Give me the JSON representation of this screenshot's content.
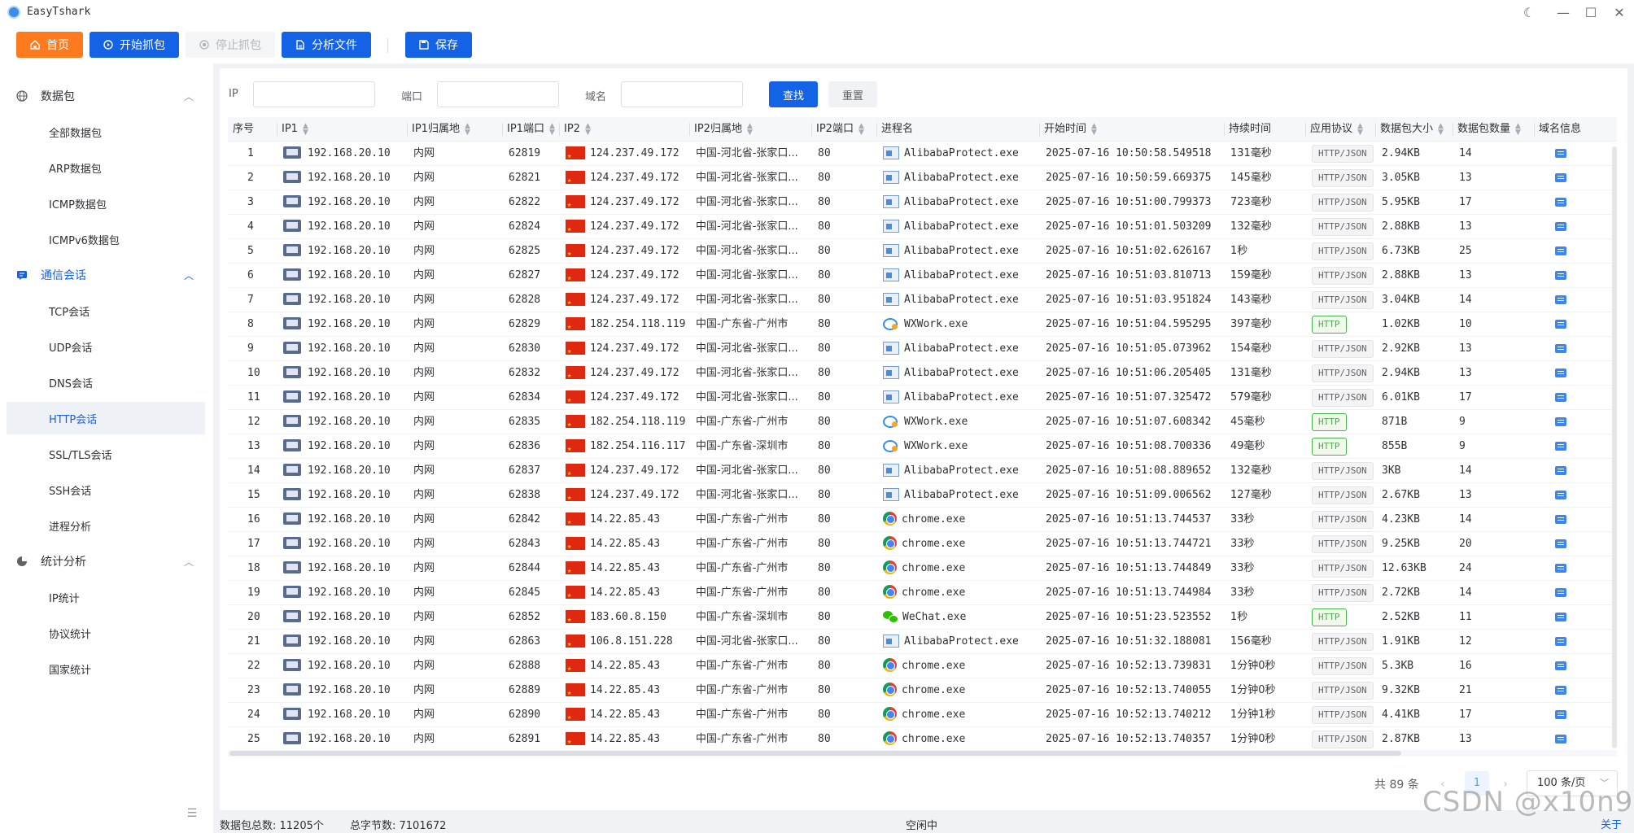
{
  "app": {
    "title": "EasyTshark"
  },
  "toolbar": {
    "home_label": "首页",
    "start_label": "开始抓包",
    "stop_label": "停止抓包",
    "analyze_label": "分析文件",
    "save_label": "保存"
  },
  "sidebar": {
    "groups": [
      {
        "label": "数据包",
        "icon": "globe-icon",
        "items": [
          "全部数据包",
          "ARP数据包",
          "ICMP数据包",
          "ICMPv6数据包"
        ]
      },
      {
        "label": "通信会话",
        "icon": "chat-icon",
        "items": [
          "TCP会话",
          "UDP会话",
          "DNS会话",
          "HTTP会话",
          "SSL/TLS会话",
          "SSH会话",
          "进程分析"
        ]
      },
      {
        "label": "统计分析",
        "icon": "pie-chart-icon",
        "items": [
          "IP统计",
          "协议统计",
          "国家统计"
        ]
      }
    ],
    "active_item": "HTTP会话"
  },
  "filters": {
    "ip_label": "IP",
    "port_label": "端口",
    "domain_label": "域名",
    "ip_value": "",
    "port_value": "",
    "domain_value": "",
    "search_label": "查找",
    "reset_label": "重置"
  },
  "table": {
    "headers": [
      "序号",
      "IP1",
      "IP1归属地",
      "IP1端口",
      "IP2",
      "IP2归属地",
      "IP2端口",
      "进程名",
      "开始时间",
      "持续时间",
      "应用协议",
      "数据包大小",
      "数据包数量",
      "域名信息"
    ],
    "rows": [
      [
        "1",
        "192.168.20.10",
        "内网",
        "62819",
        "124.237.49.172",
        "中国-河北省-张家口...",
        "80",
        "AlibabaProtect.exe",
        "2025-07-16 10:50:58.549518",
        "131毫秒",
        "HTTP/JSON",
        "2.94KB",
        "14"
      ],
      [
        "2",
        "192.168.20.10",
        "内网",
        "62821",
        "124.237.49.172",
        "中国-河北省-张家口...",
        "80",
        "AlibabaProtect.exe",
        "2025-07-16 10:50:59.669375",
        "145毫秒",
        "HTTP/JSON",
        "3.05KB",
        "13"
      ],
      [
        "3",
        "192.168.20.10",
        "内网",
        "62822",
        "124.237.49.172",
        "中国-河北省-张家口...",
        "80",
        "AlibabaProtect.exe",
        "2025-07-16 10:51:00.799373",
        "723毫秒",
        "HTTP/JSON",
        "5.95KB",
        "17"
      ],
      [
        "4",
        "192.168.20.10",
        "内网",
        "62824",
        "124.237.49.172",
        "中国-河北省-张家口...",
        "80",
        "AlibabaProtect.exe",
        "2025-07-16 10:51:01.503209",
        "132毫秒",
        "HTTP/JSON",
        "2.88KB",
        "13"
      ],
      [
        "5",
        "192.168.20.10",
        "内网",
        "62825",
        "124.237.49.172",
        "中国-河北省-张家口...",
        "80",
        "AlibabaProtect.exe",
        "2025-07-16 10:51:02.626167",
        "1秒",
        "HTTP/JSON",
        "6.73KB",
        "25"
      ],
      [
        "6",
        "192.168.20.10",
        "内网",
        "62827",
        "124.237.49.172",
        "中国-河北省-张家口...",
        "80",
        "AlibabaProtect.exe",
        "2025-07-16 10:51:03.810713",
        "159毫秒",
        "HTTP/JSON",
        "2.88KB",
        "13"
      ],
      [
        "7",
        "192.168.20.10",
        "内网",
        "62828",
        "124.237.49.172",
        "中国-河北省-张家口...",
        "80",
        "AlibabaProtect.exe",
        "2025-07-16 10:51:03.951824",
        "143毫秒",
        "HTTP/JSON",
        "3.04KB",
        "14"
      ],
      [
        "8",
        "192.168.20.10",
        "内网",
        "62829",
        "182.254.118.119",
        "中国-广东省-广州市",
        "80",
        "WXWork.exe",
        "2025-07-16 10:51:04.595295",
        "397毫秒",
        "HTTP",
        "1.02KB",
        "10"
      ],
      [
        "9",
        "192.168.20.10",
        "内网",
        "62830",
        "124.237.49.172",
        "中国-河北省-张家口...",
        "80",
        "AlibabaProtect.exe",
        "2025-07-16 10:51:05.073962",
        "154毫秒",
        "HTTP/JSON",
        "2.92KB",
        "13"
      ],
      [
        "10",
        "192.168.20.10",
        "内网",
        "62832",
        "124.237.49.172",
        "中国-河北省-张家口...",
        "80",
        "AlibabaProtect.exe",
        "2025-07-16 10:51:06.205405",
        "131毫秒",
        "HTTP/JSON",
        "2.94KB",
        "13"
      ],
      [
        "11",
        "192.168.20.10",
        "内网",
        "62834",
        "124.237.49.172",
        "中国-河北省-张家口...",
        "80",
        "AlibabaProtect.exe",
        "2025-07-16 10:51:07.325472",
        "579毫秒",
        "HTTP/JSON",
        "6.01KB",
        "17"
      ],
      [
        "12",
        "192.168.20.10",
        "内网",
        "62835",
        "182.254.118.119",
        "中国-广东省-广州市",
        "80",
        "WXWork.exe",
        "2025-07-16 10:51:07.608342",
        "45毫秒",
        "HTTP",
        "871B",
        "9"
      ],
      [
        "13",
        "192.168.20.10",
        "内网",
        "62836",
        "182.254.116.117",
        "中国-广东省-深圳市",
        "80",
        "WXWork.exe",
        "2025-07-16 10:51:08.700336",
        "49毫秒",
        "HTTP",
        "855B",
        "9"
      ],
      [
        "14",
        "192.168.20.10",
        "内网",
        "62837",
        "124.237.49.172",
        "中国-河北省-张家口...",
        "80",
        "AlibabaProtect.exe",
        "2025-07-16 10:51:08.889652",
        "132毫秒",
        "HTTP/JSON",
        "3KB",
        "14"
      ],
      [
        "15",
        "192.168.20.10",
        "内网",
        "62838",
        "124.237.49.172",
        "中国-河北省-张家口...",
        "80",
        "AlibabaProtect.exe",
        "2025-07-16 10:51:09.006562",
        "127毫秒",
        "HTTP/JSON",
        "2.67KB",
        "13"
      ],
      [
        "16",
        "192.168.20.10",
        "内网",
        "62842",
        "14.22.85.43",
        "中国-广东省-广州市",
        "80",
        "chrome.exe",
        "2025-07-16 10:51:13.744537",
        "33秒",
        "HTTP/JSON",
        "4.23KB",
        "14"
      ],
      [
        "17",
        "192.168.20.10",
        "内网",
        "62843",
        "14.22.85.43",
        "中国-广东省-广州市",
        "80",
        "chrome.exe",
        "2025-07-16 10:51:13.744721",
        "33秒",
        "HTTP/JSON",
        "9.25KB",
        "20"
      ],
      [
        "18",
        "192.168.20.10",
        "内网",
        "62844",
        "14.22.85.43",
        "中国-广东省-广州市",
        "80",
        "chrome.exe",
        "2025-07-16 10:51:13.744849",
        "33秒",
        "HTTP/JSON",
        "12.63KB",
        "24"
      ],
      [
        "19",
        "192.168.20.10",
        "内网",
        "62845",
        "14.22.85.43",
        "中国-广东省-广州市",
        "80",
        "chrome.exe",
        "2025-07-16 10:51:13.744984",
        "33秒",
        "HTTP/JSON",
        "2.72KB",
        "14"
      ],
      [
        "20",
        "192.168.20.10",
        "内网",
        "62852",
        "183.60.8.150",
        "中国-广东省-深圳市",
        "80",
        "WeChat.exe",
        "2025-07-16 10:51:23.523552",
        "1秒",
        "HTTP",
        "2.52KB",
        "11"
      ],
      [
        "21",
        "192.168.20.10",
        "内网",
        "62863",
        "106.8.151.228",
        "中国-河北省-张家口...",
        "80",
        "AlibabaProtect.exe",
        "2025-07-16 10:51:32.188081",
        "156毫秒",
        "HTTP/JSON",
        "1.91KB",
        "12"
      ],
      [
        "22",
        "192.168.20.10",
        "内网",
        "62888",
        "14.22.85.43",
        "中国-广东省-广州市",
        "80",
        "chrome.exe",
        "2025-07-16 10:52:13.739831",
        "1分钟0秒",
        "HTTP/JSON",
        "5.3KB",
        "16"
      ],
      [
        "23",
        "192.168.20.10",
        "内网",
        "62889",
        "14.22.85.43",
        "中国-广东省-广州市",
        "80",
        "chrome.exe",
        "2025-07-16 10:52:13.740055",
        "1分钟0秒",
        "HTTP/JSON",
        "9.32KB",
        "21"
      ],
      [
        "24",
        "192.168.20.10",
        "内网",
        "62890",
        "14.22.85.43",
        "中国-广东省-广州市",
        "80",
        "chrome.exe",
        "2025-07-16 10:52:13.740212",
        "1分钟1秒",
        "HTTP/JSON",
        "4.41KB",
        "17"
      ],
      [
        "25",
        "192.168.20.10",
        "内网",
        "62891",
        "14.22.85.43",
        "中国-广东省-广州市",
        "80",
        "chrome.exe",
        "2025-07-16 10:52:13.740357",
        "1分钟0秒",
        "HTTP/JSON",
        "2.87KB",
        "13"
      ]
    ]
  },
  "pagination": {
    "total_label": "共 89 条",
    "current_page": "1",
    "page_size_label": "100 条/页"
  },
  "status": {
    "packet_total": "数据包总数: 11205个",
    "byte_total": "总字节数: 7101672",
    "state": "空闲中",
    "about_label": "关于"
  },
  "watermark": "CSDN @x10n9",
  "colors": {
    "accent": "#1463e6",
    "home": "#fd7b1e",
    "http_tag": "#4cae4c"
  }
}
